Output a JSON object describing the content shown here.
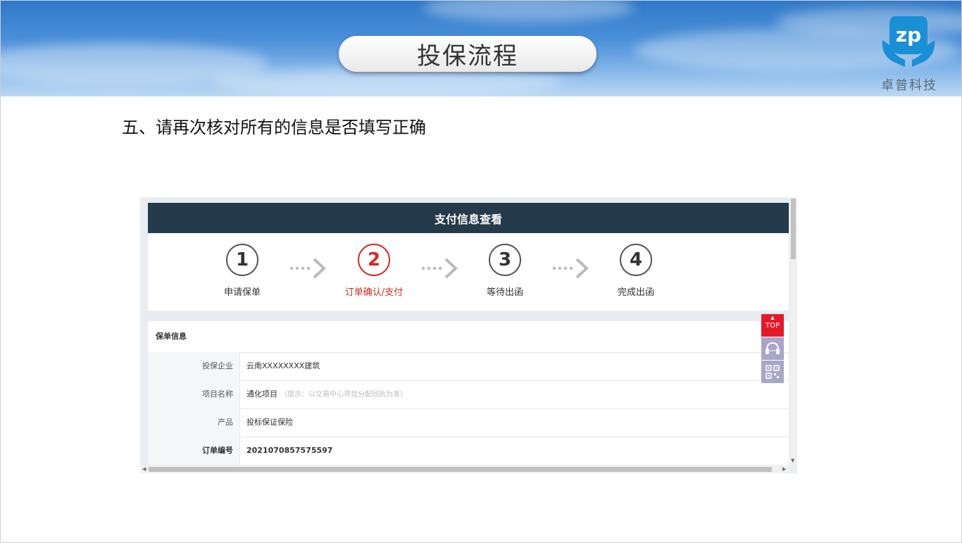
{
  "slide": {
    "title": "投保流程",
    "logo_text": "卓普科技",
    "logo_mark": "zp",
    "instruction": "五、请再次核对所有的信息是否填写正确"
  },
  "screenshot": {
    "header_title": "支付信息查看",
    "steps": [
      {
        "number": "1",
        "label": "申请保单",
        "active": false
      },
      {
        "number": "2",
        "label": "订单确认/支付",
        "active": true
      },
      {
        "number": "3",
        "label": "等待出函",
        "active": false
      },
      {
        "number": "4",
        "label": "完成出函",
        "active": false
      }
    ],
    "section_title": "保单信息",
    "rows": [
      {
        "label": "投保企业",
        "value": "云南XXXXXXXX建筑",
        "hint": ""
      },
      {
        "label": "项目名称",
        "value": "通化项目",
        "hint": "（提示：以交易中心项目分配回执为准）"
      },
      {
        "label": "产品",
        "value": "投标保证保险",
        "hint": ""
      },
      {
        "label": "订单编号",
        "value": "2021070857575597",
        "hint": ""
      }
    ],
    "float_buttons": {
      "top_label": "TOP",
      "service_icon": "headset-icon",
      "qr_icon": "qrcode-icon"
    },
    "colors": {
      "header_bg": "#253a4a",
      "active": "#d42a1e",
      "top_button": "#e6192b",
      "side_button": "#a9a6c9"
    }
  }
}
